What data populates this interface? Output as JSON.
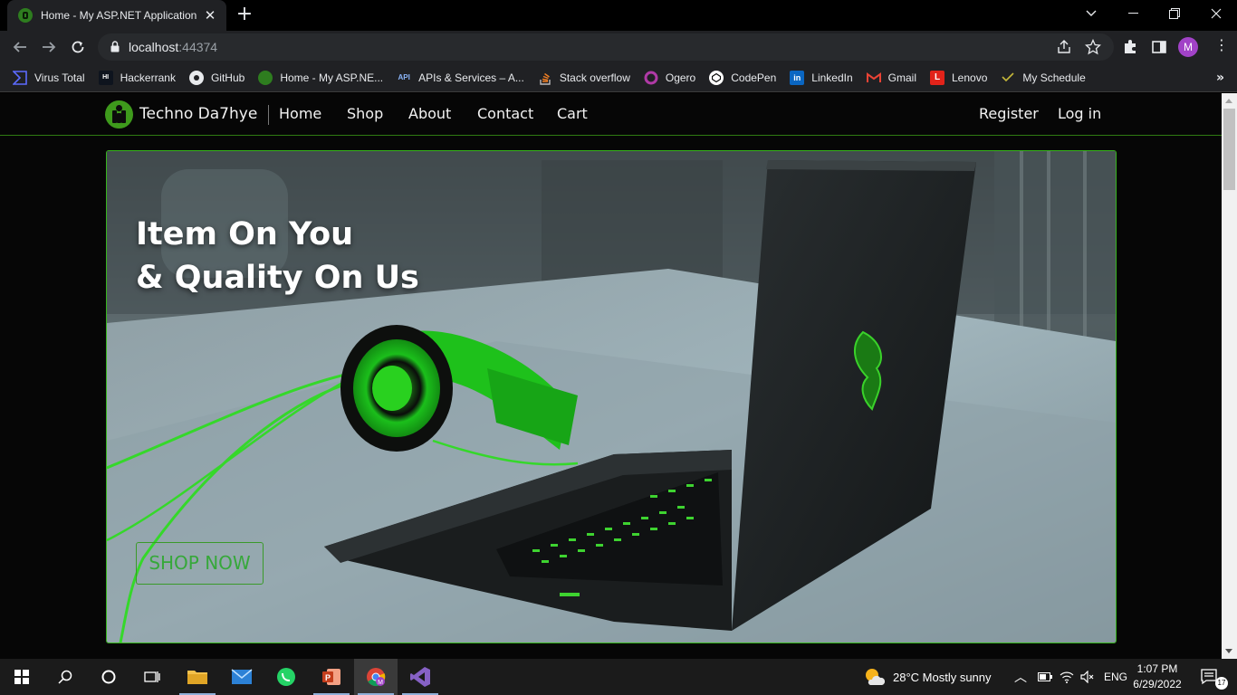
{
  "browser": {
    "tab_title": "Home - My ASP.NET Application",
    "url_host": "localhost",
    "url_port": ":44374",
    "profile_initial": "M"
  },
  "bookmarks": [
    {
      "label": "Virus Total",
      "icon": "virustotal-icon"
    },
    {
      "label": "Hackerrank",
      "icon": "hackerrank-icon"
    },
    {
      "label": "GitHub",
      "icon": "github-icon"
    },
    {
      "label": "Home - My ASP.NE...",
      "icon": "site-favicon-icon"
    },
    {
      "label": "APIs & Services – A...",
      "icon": "api-icon"
    },
    {
      "label": "Stack overflow",
      "icon": "stackoverflow-icon"
    },
    {
      "label": "Ogero",
      "icon": "ogero-icon"
    },
    {
      "label": "CodePen",
      "icon": "codepen-icon"
    },
    {
      "label": "LinkedIn",
      "icon": "linkedin-icon"
    },
    {
      "label": "Gmail",
      "icon": "gmail-icon"
    },
    {
      "label": "Lenovo",
      "icon": "lenovo-icon"
    },
    {
      "label": "My Schedule",
      "icon": "schedule-icon"
    }
  ],
  "site": {
    "brand": "Techno Da7hye",
    "nav": [
      "Home",
      "Shop",
      "About",
      "Contact",
      "Cart"
    ],
    "auth": {
      "register": "Register",
      "login": "Log in"
    },
    "accent_color": "#36b41c"
  },
  "hero": {
    "title_line1": "Item On You",
    "title_line2": "& Quality On Us",
    "button": "SHOP NOW"
  },
  "taskbar": {
    "weather": "28°C  Mostly sunny",
    "language": "ENG",
    "time": "1:07 PM",
    "date": "6/29/2022",
    "notifications": "17"
  }
}
